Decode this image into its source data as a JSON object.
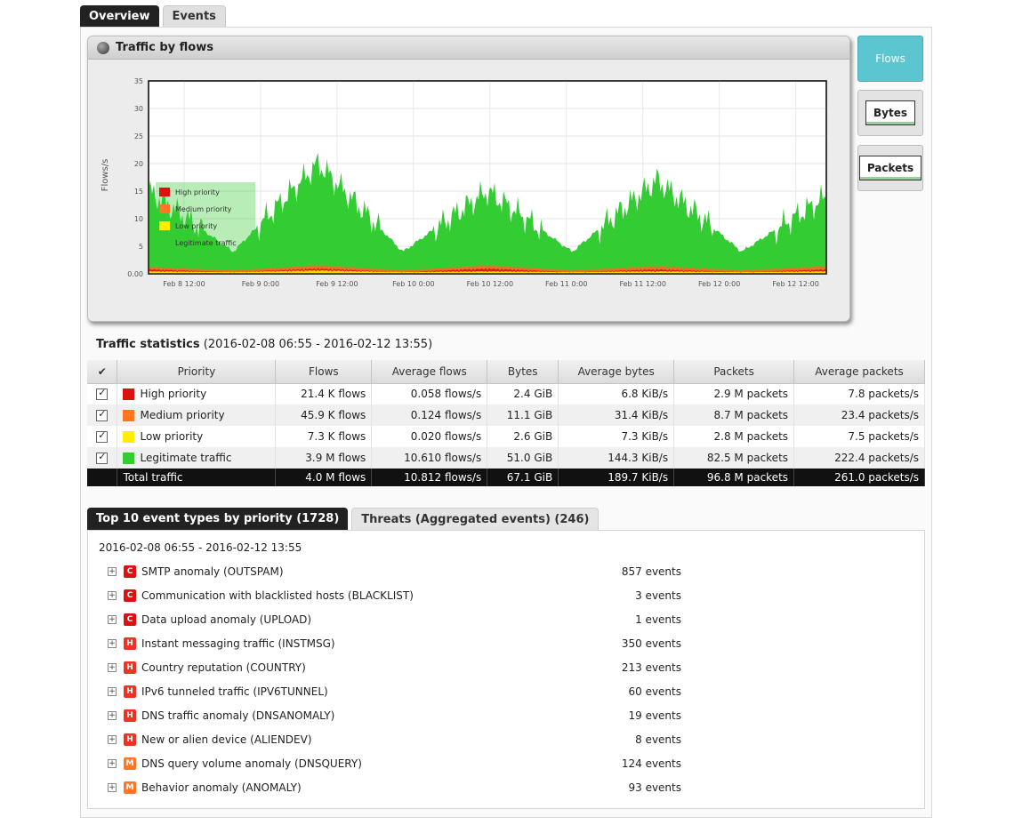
{
  "top_tabs": [
    {
      "label": "Overview"
    },
    {
      "label": "Events"
    }
  ],
  "chart": {
    "header": "Traffic by flows",
    "ylabel": "Flows/s",
    "yticks": [
      "25",
      "20",
      "15",
      "10",
      "5",
      "0.00"
    ],
    "yticks_extra": [
      "30",
      "35"
    ],
    "xticks": [
      "Feb 8 12:00",
      "Feb 9 0:00",
      "Feb 9 12:00",
      "Feb 10 0:00",
      "Feb 10 12:00",
      "Feb 11 0:00",
      "Feb 11 12:00",
      "Feb 12 0:00",
      "Feb 12 12:00"
    ],
    "legend": [
      "High priority",
      "Medium priority",
      "Low priority",
      "Legitimate traffic"
    ]
  },
  "chart_data": {
    "type": "area",
    "title": "Traffic by flows",
    "ylabel": "Flows/s",
    "xlabel": "",
    "ylim": [
      0,
      35
    ],
    "x": [
      "Feb 8 12:00",
      "Feb 9 0:00",
      "Feb 9 12:00",
      "Feb 10 0:00",
      "Feb 10 12:00",
      "Feb 11 0:00",
      "Feb 11 12:00",
      "Feb 12 0:00",
      "Feb 12 12:00"
    ],
    "series": [
      {
        "name": "Legitimate traffic",
        "color": "#33cc33",
        "values": [
          15,
          4,
          20,
          4,
          15,
          4,
          17,
          4,
          14
        ]
      },
      {
        "name": "Low priority",
        "color": "#ffee00",
        "values": [
          0.3,
          0.2,
          0.4,
          0.2,
          0.3,
          0.2,
          0.3,
          0.2,
          0.3
        ]
      },
      {
        "name": "Medium priority",
        "color": "#ff6622",
        "values": [
          0.8,
          0.4,
          1.0,
          0.4,
          1.0,
          0.4,
          0.9,
          0.4,
          0.9
        ]
      },
      {
        "name": "High priority",
        "color": "#dd1111",
        "values": [
          0.5,
          0.2,
          0.6,
          0.2,
          0.6,
          0.2,
          0.5,
          0.2,
          0.5
        ]
      }
    ],
    "grid": true,
    "legend_position": "bottom-left"
  },
  "side_buttons": [
    {
      "label": "Flows"
    },
    {
      "label": "Bytes"
    },
    {
      "label": "Packets"
    }
  ],
  "stats": {
    "title": "Traffic statistics",
    "range": "(2016-02-08 06:55 - 2016-02-12 13:55)",
    "headers": {
      "check": "✔",
      "priority": "Priority",
      "flows": "Flows",
      "avg_flows": "Average flows",
      "bytes": "Bytes",
      "avg_bytes": "Average bytes",
      "packets": "Packets",
      "avg_packets": "Average packets"
    },
    "rows": [
      {
        "color": "#dd1111",
        "priority": "High priority",
        "flows": "21.4 K flows",
        "avg_flows": "0.058 flows/s",
        "bytes": "2.4 GiB",
        "avg_bytes": "6.8 KiB/s",
        "packets": "2.9 M packets",
        "avg_packets": "7.8 packets/s"
      },
      {
        "color": "#ff7722",
        "priority": "Medium priority",
        "flows": "45.9 K flows",
        "avg_flows": "0.124 flows/s",
        "bytes": "11.1 GiB",
        "avg_bytes": "31.4 KiB/s",
        "packets": "8.7 M packets",
        "avg_packets": "23.4 packets/s"
      },
      {
        "color": "#ffee00",
        "priority": "Low priority",
        "flows": "7.3 K flows",
        "avg_flows": "0.020 flows/s",
        "bytes": "2.6 GiB",
        "avg_bytes": "7.3 KiB/s",
        "packets": "2.8 M packets",
        "avg_packets": "7.5 packets/s"
      },
      {
        "color": "#33cc33",
        "priority": "Legitimate traffic",
        "flows": "3.9 M flows",
        "avg_flows": "10.610 flows/s",
        "bytes": "51.0 GiB",
        "avg_bytes": "144.3 KiB/s",
        "packets": "82.5 M packets",
        "avg_packets": "222.4 packets/s"
      }
    ],
    "total": {
      "priority": "Total traffic",
      "flows": "4.0 M flows",
      "avg_flows": "10.812 flows/s",
      "bytes": "67.1 GiB",
      "avg_bytes": "189.7 KiB/s",
      "packets": "96.8 M packets",
      "avg_packets": "261.0 packets/s"
    }
  },
  "events": {
    "tabs": [
      {
        "label": "Top 10 event types by priority (1728)"
      },
      {
        "label": "Threats (Aggregated events) (246)"
      }
    ],
    "range": "2016-02-08 06:55 - 2016-02-12 13:55",
    "items": [
      {
        "sev": "C",
        "color": "#dd1111",
        "name": "SMTP anomaly (OUTSPAM)",
        "count": "857 events"
      },
      {
        "sev": "C",
        "color": "#dd1111",
        "name": "Communication with blacklisted hosts (BLACKLIST)",
        "count": "3 events"
      },
      {
        "sev": "C",
        "color": "#dd1111",
        "name": "Data upload anomaly (UPLOAD)",
        "count": "1 events"
      },
      {
        "sev": "H",
        "color": "#ee3322",
        "name": "Instant messaging traffic (INSTMSG)",
        "count": "350 events"
      },
      {
        "sev": "H",
        "color": "#ee3322",
        "name": "Country reputation (COUNTRY)",
        "count": "213 events"
      },
      {
        "sev": "H",
        "color": "#ee3322",
        "name": "IPv6 tunneled traffic (IPV6TUNNEL)",
        "count": "60 events"
      },
      {
        "sev": "H",
        "color": "#ee3322",
        "name": "DNS traffic anomaly (DNSANOMALY)",
        "count": "19 events"
      },
      {
        "sev": "H",
        "color": "#ee3322",
        "name": "New or alien device (ALIENDEV)",
        "count": "8 events"
      },
      {
        "sev": "M",
        "color": "#ff7722",
        "name": "DNS query volume anomaly (DNSQUERY)",
        "count": "124 events"
      },
      {
        "sev": "M",
        "color": "#ff7722",
        "name": "Behavior anomaly (ANOMALY)",
        "count": "93 events"
      }
    ]
  }
}
